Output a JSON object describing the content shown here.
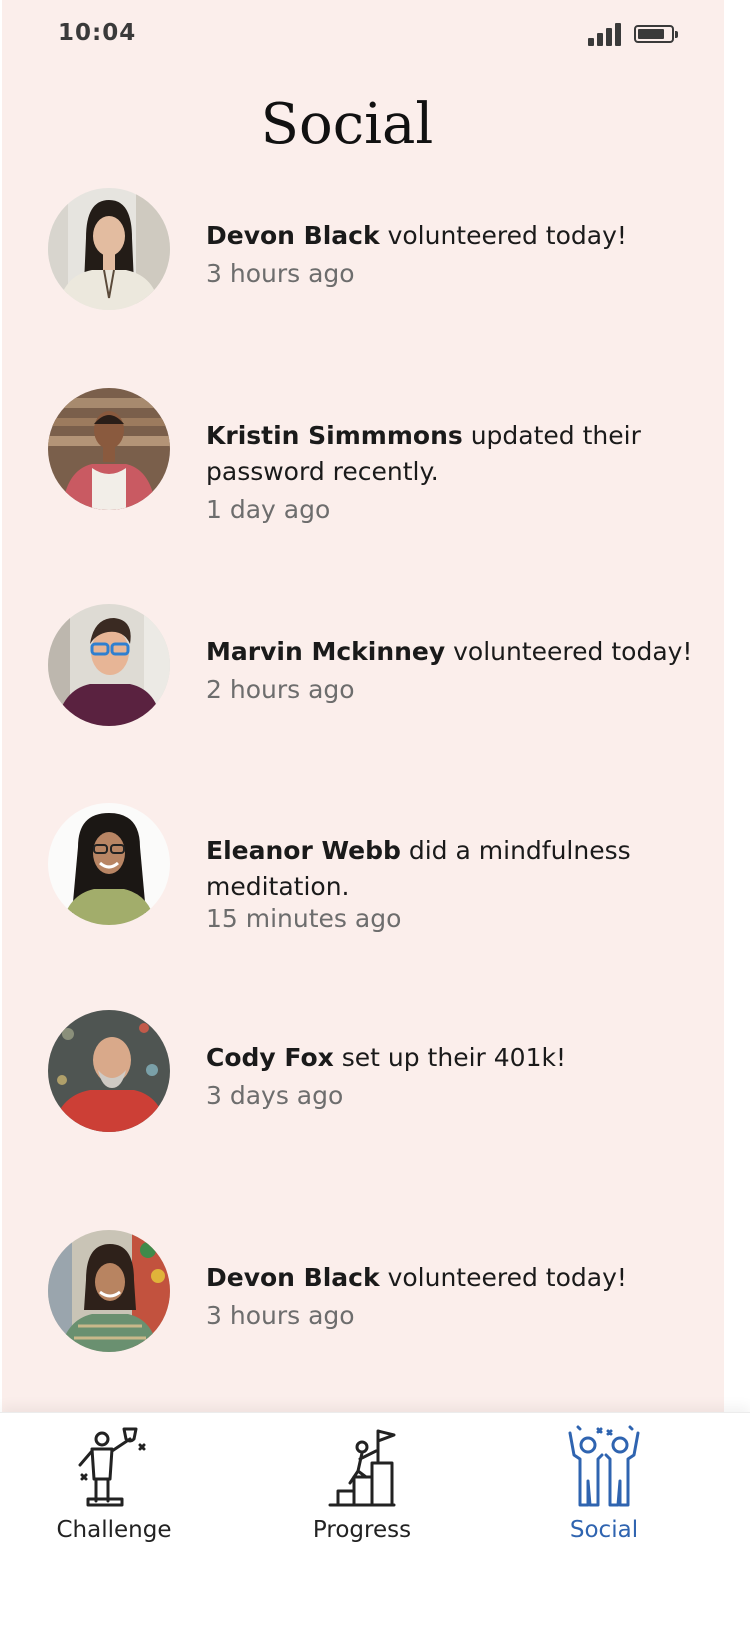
{
  "status_bar": {
    "time": "10:04"
  },
  "header": {
    "title": "Social"
  },
  "feed": [
    {
      "name": "Devon Black",
      "action": " volunteered today!",
      "time": "3 hours ago"
    },
    {
      "name": "Kristin Simmmons",
      "action": " updated their password recently.",
      "time": "1 day ago"
    },
    {
      "name": "Marvin Mckinney",
      "action": " volunteered today!",
      "time": "2 hours ago"
    },
    {
      "name": "Eleanor Webb",
      "action": " did a mindfulness meditation.",
      "time": "15 minutes ago"
    },
    {
      "name": "Cody Fox",
      "action": " set up their 401k!",
      "time": "3 days ago"
    },
    {
      "name": "Devon Black",
      "action": " volunteered today!",
      "time": "3 hours ago"
    }
  ],
  "tabbar": {
    "tabs": [
      {
        "label": "Challenge",
        "icon": "trophy-person-icon",
        "active": false
      },
      {
        "label": "Progress",
        "icon": "climbing-stairs-flag-icon",
        "active": false
      },
      {
        "label": "Social",
        "icon": "two-people-cheering-icon",
        "active": true
      }
    ],
    "active_color": "#2f64b0",
    "inactive_color": "#222222"
  },
  "colors": {
    "background": "#fbeeeb",
    "text": "#1a1a1a",
    "muted": "#6d6d6d"
  }
}
